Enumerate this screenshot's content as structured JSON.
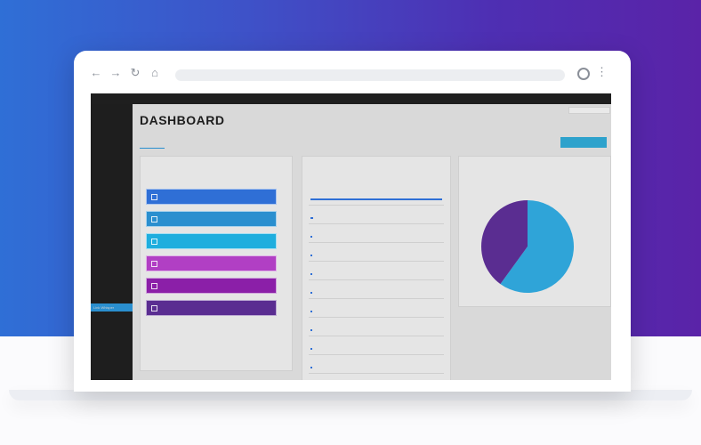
{
  "colors": {
    "internal": "#2fa4d8",
    "external": "#5a2d91",
    "accent": "#2a8fcf",
    "stat_buttons": [
      "#2f6fd6",
      "#2a8fcf",
      "#1faede",
      "#b13fc4",
      "#8b1fa8",
      "#5a2d91"
    ]
  },
  "browser": {
    "back_icon": "←",
    "forward_icon": "→",
    "reload_icon": "↻",
    "home_icon": "⌂",
    "menu_icon": "⋮"
  },
  "page": {
    "title": "DASHBOARD"
  },
  "sidebar": {
    "active_label": "Link Whisper"
  },
  "pie": {
    "internal_percent": 60,
    "external_percent": 40
  }
}
